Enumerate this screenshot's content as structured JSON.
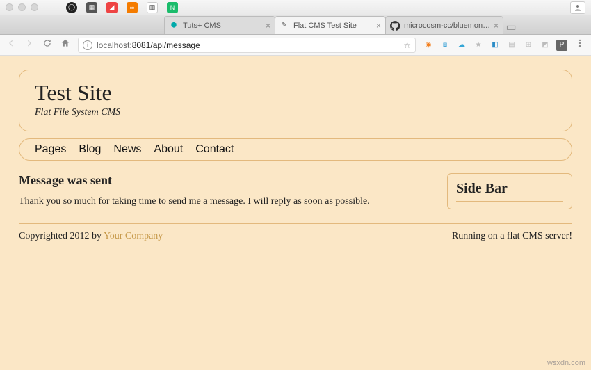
{
  "browser": {
    "tabs": [
      {
        "label": "Tuts+ CMS"
      },
      {
        "label": "Flat CMS Test Site"
      },
      {
        "label": "microcosm-cc/bluemonday: bl"
      }
    ],
    "url_host": "localhost:",
    "url_port": "8081",
    "url_path": "/api/message"
  },
  "site": {
    "title": "Test Site",
    "tagline": "Flat File System CMS",
    "nav": [
      "Pages",
      "Blog",
      "News",
      "About",
      "Contact"
    ]
  },
  "content": {
    "heading": "Message was sent",
    "body": "Thank you so much for taking time to send me a message. I will reply as soon as possible."
  },
  "sidebar": {
    "title": "Side Bar"
  },
  "footer": {
    "copyright_prefix": "Copyrighted 2012 by ",
    "company": "Your Company",
    "server_note": "Running on a flat CMS server!"
  },
  "watermark": "wsxdn.com"
}
